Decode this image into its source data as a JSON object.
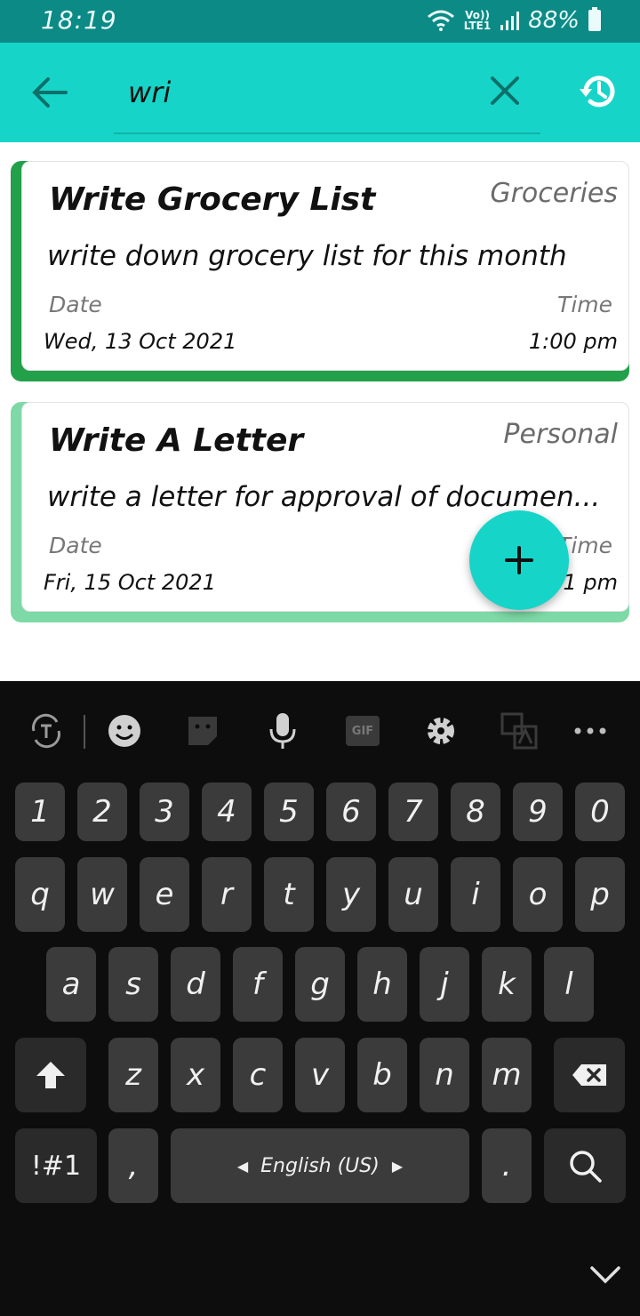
{
  "status_bar": {
    "time": "18:19",
    "network": "LTE1",
    "volte": "Vo))",
    "battery": "88%"
  },
  "app_bar": {
    "search_value": "wri",
    "icons": {
      "back": "arrow-left-icon",
      "clear": "close-icon",
      "history": "history-icon"
    }
  },
  "notes": [
    {
      "title": "Write Grocery List",
      "category": "Groceries",
      "description": "write down  grocery list for this month",
      "date_label": "Date",
      "time_label": "Time",
      "date": "Wed, 13 Oct 2021",
      "time": "1:00 pm",
      "accent": "#22a04a"
    },
    {
      "title": "Write A Letter",
      "category": "Personal",
      "description": "write a letter for approval of documen...",
      "date_label": "Date",
      "time_label": "Time",
      "date": "Fri, 15 Oct 2021",
      "time": "1 pm",
      "accent": "#7dd9a6"
    }
  ],
  "fab": {
    "label": "+"
  },
  "keyboard": {
    "toolbar_icons": [
      "translate-icon",
      "emoji-icon",
      "sticker-icon",
      "mic-icon",
      "gif-icon",
      "settings-icon",
      "translate-screen-icon",
      "more-icon"
    ],
    "gif_label": "GIF",
    "number_row": [
      "1",
      "2",
      "3",
      "4",
      "5",
      "6",
      "7",
      "8",
      "9",
      "0"
    ],
    "row1": [
      "q",
      "w",
      "e",
      "r",
      "t",
      "y",
      "u",
      "i",
      "o",
      "p"
    ],
    "row2": [
      "a",
      "s",
      "d",
      "f",
      "g",
      "h",
      "j",
      "k",
      "l"
    ],
    "row3": [
      "z",
      "x",
      "c",
      "v",
      "b",
      "n",
      "m"
    ],
    "symbols_label": "!#1",
    "comma_label": ",",
    "space_label": "English (US)",
    "period_label": ".",
    "colors": {
      "background": "#0d0d0d",
      "key": "#3b3b3b"
    }
  },
  "colors": {
    "status_bar": "#0b8a86",
    "app_bar": "#16d5c8",
    "fab": "#16d5c8"
  }
}
